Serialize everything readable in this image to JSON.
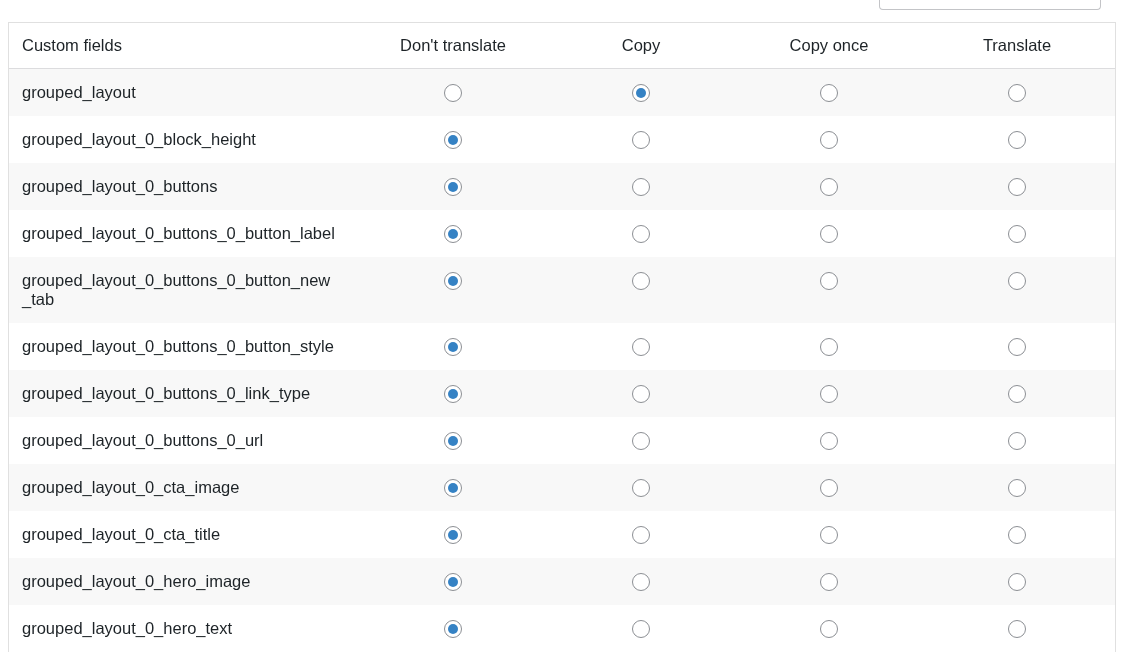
{
  "table": {
    "columns": [
      "Custom fields",
      "Don't translate",
      "Copy",
      "Copy once",
      "Translate"
    ],
    "rows": [
      {
        "name": "grouped_layout",
        "options": [
          {
            "selected": false
          },
          {
            "selected": true
          },
          {
            "selected": false
          },
          {
            "selected": false
          }
        ]
      },
      {
        "name": "grouped_layout_0_block_height",
        "options": [
          {
            "selected": true
          },
          {
            "selected": false
          },
          {
            "selected": false
          },
          {
            "selected": false
          }
        ]
      },
      {
        "name": "grouped_layout_0_buttons",
        "options": [
          {
            "selected": true
          },
          {
            "selected": false
          },
          {
            "selected": false
          },
          {
            "selected": false
          }
        ]
      },
      {
        "name": "grouped_layout_0_buttons_0_button_label",
        "options": [
          {
            "selected": true
          },
          {
            "selected": false
          },
          {
            "selected": false
          },
          {
            "selected": false
          }
        ]
      },
      {
        "name": "grouped_layout_0_buttons_0_button_new_tab",
        "options": [
          {
            "selected": true
          },
          {
            "selected": false
          },
          {
            "selected": false
          },
          {
            "selected": false
          }
        ]
      },
      {
        "name": "grouped_layout_0_buttons_0_button_style",
        "options": [
          {
            "selected": true
          },
          {
            "selected": false
          },
          {
            "selected": false
          },
          {
            "selected": false
          }
        ]
      },
      {
        "name": "grouped_layout_0_buttons_0_link_type",
        "options": [
          {
            "selected": true
          },
          {
            "selected": false
          },
          {
            "selected": false
          },
          {
            "selected": false
          }
        ]
      },
      {
        "name": "grouped_layout_0_buttons_0_url",
        "options": [
          {
            "selected": true
          },
          {
            "selected": false
          },
          {
            "selected": false
          },
          {
            "selected": false
          }
        ]
      },
      {
        "name": "grouped_layout_0_cta_image",
        "options": [
          {
            "selected": true
          },
          {
            "selected": false
          },
          {
            "selected": false
          },
          {
            "selected": false
          }
        ]
      },
      {
        "name": "grouped_layout_0_cta_title",
        "options": [
          {
            "selected": true
          },
          {
            "selected": false
          },
          {
            "selected": false
          },
          {
            "selected": false
          }
        ]
      },
      {
        "name": "grouped_layout_0_hero_image",
        "options": [
          {
            "selected": true
          },
          {
            "selected": false
          },
          {
            "selected": false
          },
          {
            "selected": false
          }
        ]
      },
      {
        "name": "grouped_layout_0_hero_text",
        "options": [
          {
            "selected": true
          },
          {
            "selected": false
          },
          {
            "selected": false
          },
          {
            "selected": false
          }
        ]
      }
    ]
  }
}
